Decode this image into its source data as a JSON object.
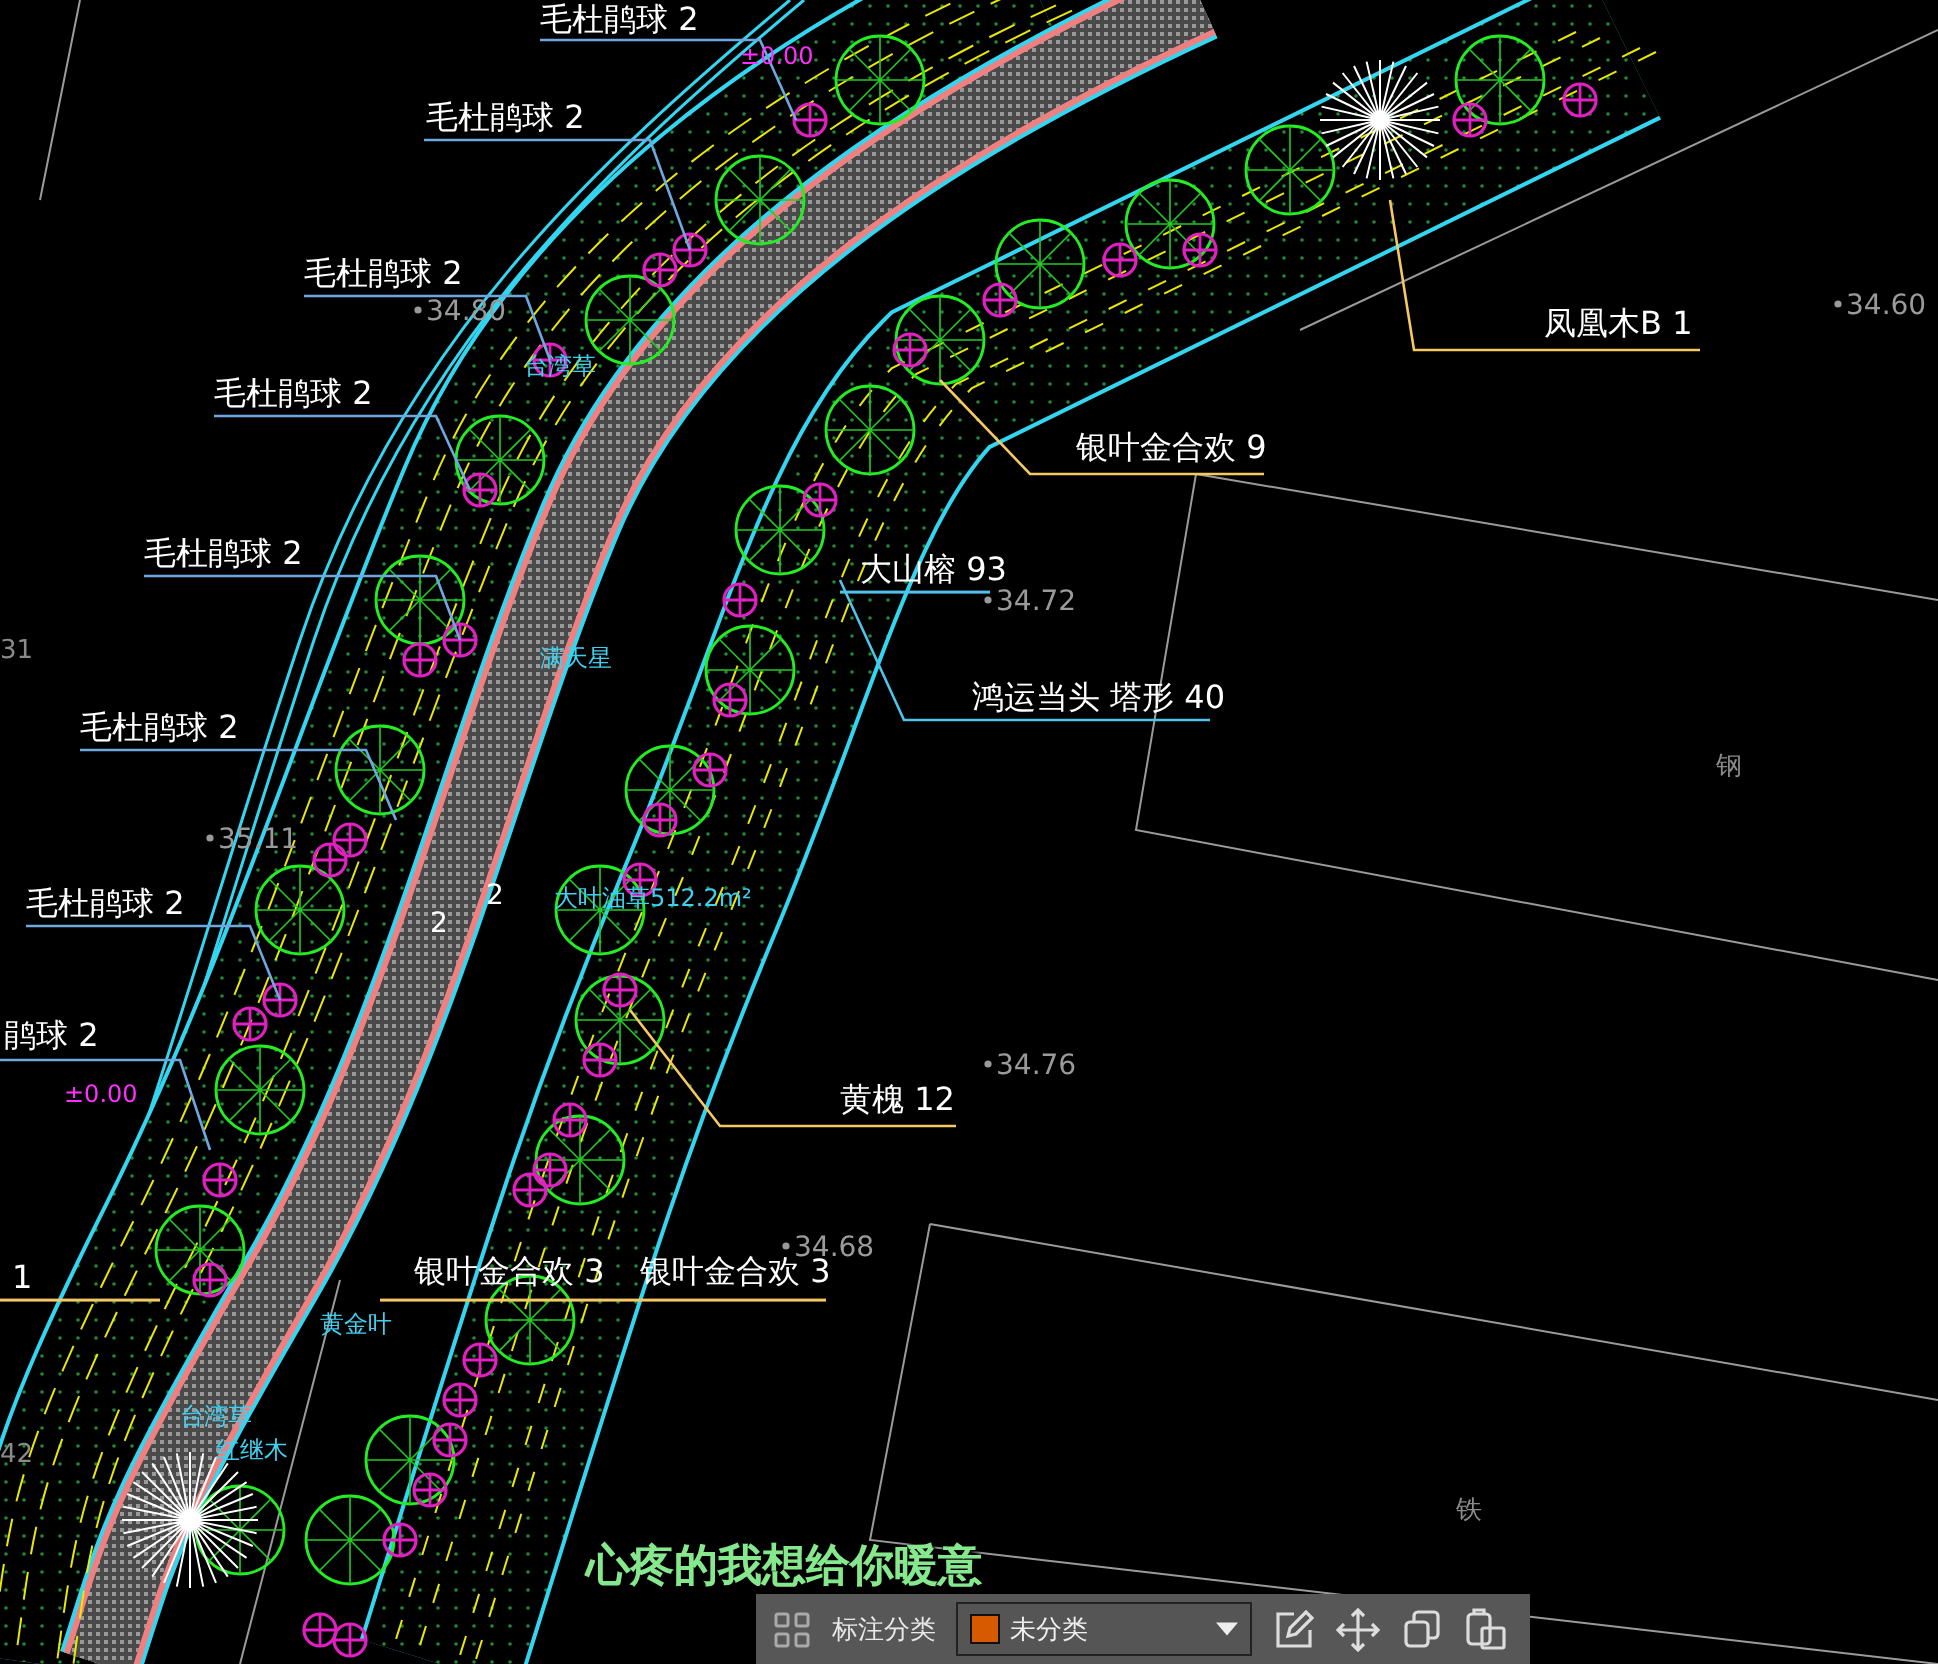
{
  "plant_labels": [
    {
      "text": "毛杜鹃球 2",
      "color": "#6fa8e0"
    },
    {
      "text": "毛杜鹃球 2",
      "color": "#6fa8e0"
    },
    {
      "text": "毛杜鹃球 2",
      "color": "#6fa8e0"
    },
    {
      "text": "毛杜鹃球 2",
      "color": "#6fa8e0"
    },
    {
      "text": "毛杜鹃球 2",
      "color": "#6fa8e0"
    },
    {
      "text": "毛杜鹃球 2",
      "color": "#6fa8e0"
    },
    {
      "text": "毛杜鹃球 2",
      "color": "#6fa8e0"
    },
    {
      "text": "鹃球 2",
      "color": "#6fa8e0"
    },
    {
      "text": "1",
      "color": "#f5c862"
    },
    {
      "text": "银叶金合欢 3",
      "color": "#f5c862"
    },
    {
      "text": "银叶金合欢 3",
      "color": "#f5c862"
    },
    {
      "text": "黄槐 12",
      "color": "#f5c862"
    },
    {
      "text": "鸿运当头 塔形 40",
      "color": "#4fc3e8"
    },
    {
      "text": "大山榕 93",
      "color": "#4fc3e8"
    },
    {
      "text": "银叶金合欢 9",
      "color": "#f5c862"
    },
    {
      "text": "凤凰木B 1",
      "color": "#f5c862"
    }
  ],
  "elevations": [
    "34.60",
    "34.72",
    "34.76",
    "34.68",
    "34.80",
    "35.11"
  ],
  "plan_notes": [
    {
      "text": "满天星",
      "kind": "plant"
    },
    {
      "text": "大叶油草512.2m²",
      "kind": "plant"
    },
    {
      "text": "黄金叶",
      "kind": "plant"
    },
    {
      "text": "台湾草",
      "kind": "plant"
    },
    {
      "text": "红继木",
      "kind": "plant"
    },
    {
      "text": "台湾草",
      "kind": "plant"
    },
    {
      "text": "±0.00",
      "kind": "level"
    },
    {
      "text": "±0.00",
      "kind": "level"
    },
    {
      "text": "2",
      "kind": "mark"
    },
    {
      "text": "2",
      "kind": "mark"
    },
    {
      "text": "31",
      "kind": "edge"
    },
    {
      "text": "42",
      "kind": "edge"
    },
    {
      "text": "钢",
      "kind": "edge"
    },
    {
      "text": "铁",
      "kind": "edge"
    }
  ],
  "subtitle": "心疼的我想给你暖意",
  "toolbar": {
    "label": "标注分类",
    "dropdown": {
      "value": "未分类",
      "color": "#d85a00"
    }
  }
}
